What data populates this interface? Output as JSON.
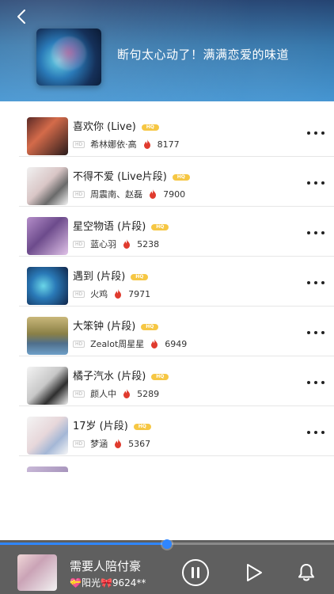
{
  "header": {
    "title": "断句太心动了！满满恋爱的味道",
    "back_icon": "chevron-left-icon"
  },
  "badges": {
    "hq": "HQ",
    "hd": "HD"
  },
  "songs": [
    {
      "title": "喜欢你 (Live)",
      "artist": "希林娜依·高",
      "plays": "8177"
    },
    {
      "title": "不得不爱 (Live片段)",
      "artist": "周震南、赵磊",
      "plays": "7900"
    },
    {
      "title": "星空物语 (片段)",
      "artist": "蓝心羽",
      "plays": "5238"
    },
    {
      "title": "遇到 (片段)",
      "artist": "火鸡",
      "plays": "7971"
    },
    {
      "title": "大笨钟 (片段)",
      "artist": "Zealot周星星",
      "plays": "6949"
    },
    {
      "title": "橘子汽水 (片段)",
      "artist": "颜人中",
      "plays": "5289"
    },
    {
      "title": "17岁 (片段)",
      "artist": "梦涵",
      "plays": "5367"
    }
  ],
  "player": {
    "title": "需要人陪付豪",
    "subtitle": "💝阳光🎀9624**",
    "progress": 0.5,
    "pause_icon": "pause-icon",
    "play_icon": "play-icon",
    "bell_icon": "bell-icon"
  },
  "colors": {
    "accent": "#2f86ff",
    "badge": "#f6c744",
    "fire": "#e03b2e"
  }
}
